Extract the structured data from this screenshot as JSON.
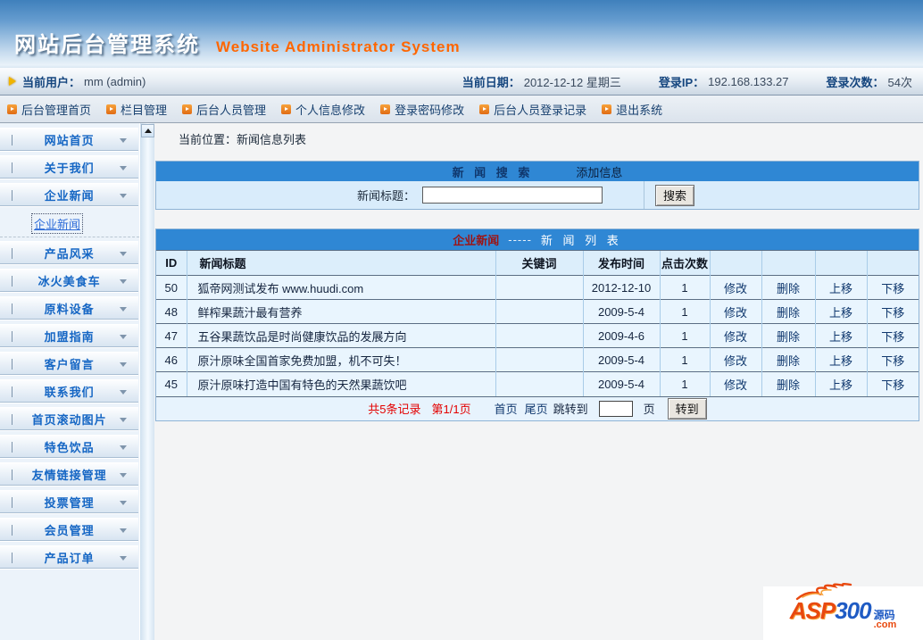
{
  "header": {
    "title_cn": "网站后台管理系统",
    "title_en": "Website Administrator System"
  },
  "infobar": {
    "user_label": "当前用户：",
    "user_value": "mm (admin)",
    "date_label": "当前日期：",
    "date_value": "2012-12-12 星期三",
    "ip_label": "登录IP：",
    "ip_value": "192.168.133.27",
    "count_label": "登录次数：",
    "count_value": "54次"
  },
  "topnav": {
    "items": [
      "后台管理首页",
      "栏目管理",
      "后台人员管理",
      "个人信息修改",
      "登录密码修改",
      "后台人员登录记录",
      "退出系统"
    ]
  },
  "sidebar": {
    "items": [
      {
        "label": "网站首页"
      },
      {
        "label": "关于我们"
      },
      {
        "label": "企业新闻",
        "sub": [
          "企业新闻"
        ]
      },
      {
        "label": "产品风采"
      },
      {
        "label": "冰火美食车"
      },
      {
        "label": "原料设备"
      },
      {
        "label": "加盟指南"
      },
      {
        "label": "客户留言"
      },
      {
        "label": "联系我们"
      },
      {
        "label": "首页滚动图片"
      },
      {
        "label": "特色饮品"
      },
      {
        "label": "友情链接管理"
      },
      {
        "label": "投票管理"
      },
      {
        "label": "会员管理"
      },
      {
        "label": "产品订单"
      }
    ]
  },
  "breadcrumb": {
    "text": "当前位置：新闻信息列表"
  },
  "search_panel": {
    "header_title": "新 闻 搜 索",
    "add_link": "添加信息",
    "field_label": "新闻标题：",
    "input_value": "",
    "button_label": "搜索"
  },
  "news_table": {
    "title_red": "企业新闻",
    "title_sep": "-----",
    "title_white": "新 闻 列 表",
    "columns": [
      "ID",
      "新闻标题",
      "关键词",
      "发布时间",
      "点击次数"
    ],
    "action_labels": [
      "修改",
      "删除",
      "上移",
      "下移"
    ],
    "rows": [
      {
        "id": "50",
        "title": "狐帝网测试发布 www.huudi.com",
        "keyword": "",
        "date": "2012-12-10",
        "clicks": "1"
      },
      {
        "id": "48",
        "title": "鲜榨果蔬汁最有营养",
        "keyword": "",
        "date": "2009-5-4",
        "clicks": "1"
      },
      {
        "id": "47",
        "title": "五谷果蔬饮品是时尚健康饮品的发展方向",
        "keyword": "",
        "date": "2009-4-6",
        "clicks": "1"
      },
      {
        "id": "46",
        "title": "原汁原味全国首家免费加盟，机不可失！",
        "keyword": "",
        "date": "2009-5-4",
        "clicks": "1"
      },
      {
        "id": "45",
        "title": "原汁原味打造中国有特色的天然果蔬饮吧",
        "keyword": "",
        "date": "2009-5-4",
        "clicks": "1"
      }
    ]
  },
  "pagination": {
    "total": "共5条记录",
    "page": "第1/1页",
    "first": "首页",
    "last": "尾页",
    "jump_label": "跳转到",
    "jump_value": "",
    "page_suffix": "页",
    "go_button": "转到"
  },
  "logo": {
    "asp": "ASP",
    "num": "300",
    "yuanma": "源码",
    "com": ".com"
  },
  "colors": {
    "bar_blue": "#2f87d4",
    "banner_orange": "#ff6600",
    "sidebar_link_blue": "#1566c4",
    "record_red": "#e30000",
    "table_title_red": "#9c1414"
  }
}
